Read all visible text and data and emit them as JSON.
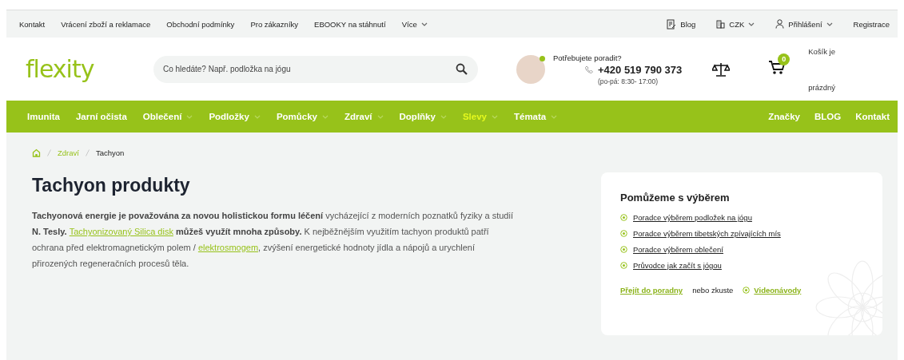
{
  "top_bar": {
    "links": [
      "Kontakt",
      "Vrácení zboží a reklamace",
      "Obchodní podmínky",
      "Pro zákazníky",
      "EBOOKY na stáhnutí"
    ],
    "more": "Více",
    "right": [
      {
        "kind": "blog",
        "label": "Blog",
        "has_menu": false
      },
      {
        "kind": "currency",
        "label": "CZK",
        "has_menu": true
      },
      {
        "kind": "user",
        "label": "Přihlášení",
        "has_menu": true
      },
      {
        "kind": "plain",
        "label": "Registrace",
        "has_menu": false
      }
    ]
  },
  "header": {
    "logo": "flexity",
    "search": {
      "placeholder": "Co hledáte? Např. podložka na jógu"
    },
    "support": {
      "online": true,
      "prompt": "Potřebujete poradit?",
      "phone": "+420 519 790 373",
      "hours": "(po-pá: 8:30- 17:00)"
    },
    "cart": {
      "count": "0",
      "text_1": "Košík je",
      "text_2": "prázdný"
    }
  },
  "nav": {
    "items": [
      {
        "label": "Imunita",
        "has_submenu": false,
        "highlighted": false
      },
      {
        "label": "Jarní očista",
        "has_submenu": false,
        "highlighted": false
      },
      {
        "label": "Oblečení",
        "has_submenu": true,
        "highlighted": false
      },
      {
        "label": "Podložky",
        "has_submenu": true,
        "highlighted": false
      },
      {
        "label": "Pomůcky",
        "has_submenu": true,
        "highlighted": false
      },
      {
        "label": "Zdraví",
        "has_submenu": true,
        "highlighted": false
      },
      {
        "label": "Doplňky",
        "has_submenu": true,
        "highlighted": false
      },
      {
        "label": "Slevy",
        "has_submenu": true,
        "highlighted": true
      },
      {
        "label": "Témata",
        "has_submenu": true,
        "highlighted": false
      }
    ],
    "right": [
      "Značky",
      "BLOG",
      "Kontakt"
    ]
  },
  "breadcrumb": {
    "items": [
      "Zdraví",
      "Tachyon"
    ]
  },
  "title": "Tachyon produkty",
  "intro": [
    {
      "kind": "bold",
      "text": "Tachyonová energie je považována za novou holistickou formu léčení"
    },
    {
      "kind": "text",
      "text": " vycházející z moderních poznatků fyziky a studií "
    },
    {
      "kind": "bold",
      "text": "N. Tesly. "
    },
    {
      "kind": "link",
      "text": "Tachyonizovaný Silica disk"
    },
    {
      "kind": "bold",
      "text": " můžeš využít mnoha způsoby."
    },
    {
      "kind": "text",
      "text": " K nejběžnějším využitím tachyon produktů patří ochrana před elektromagnetickým polem / "
    },
    {
      "kind": "link",
      "text": "elektrosmogem"
    },
    {
      "kind": "text",
      "text": ", zvýšení energetické hodnoty jídla a nápojů a urychlení přirozených regeneračních procesů těla."
    }
  ],
  "help_box": {
    "title": "Pomůžeme s výběrem",
    "links": [
      "Poradce výběrem podložek na jógu",
      "Poradce výběrem tibetských zpívajících mís",
      "Poradce výběrem oblečení",
      "Průvodce jak začít s jógou"
    ],
    "footer_link": "Přejít do poradny",
    "or_text": "nebo zkuste",
    "video_link": "Videonávody"
  }
}
